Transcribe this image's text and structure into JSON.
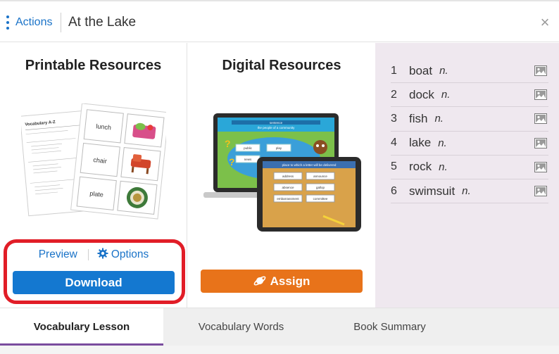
{
  "header": {
    "actions_label": "Actions",
    "title": "At the Lake",
    "close_symbol": "×"
  },
  "printable": {
    "title": "Printable Resources",
    "preview_label": "Preview",
    "options_label": "Options",
    "download_label": "Download",
    "worksheet_heading": "Vocabulary A-Z",
    "cards": [
      "lunch",
      "chair",
      "plate"
    ]
  },
  "digital": {
    "title": "Digital Resources",
    "assign_label": "Assign",
    "laptop_prompt": "sentence",
    "laptop_subprompt": "the people of a community",
    "laptop_answers": [
      "public",
      "play",
      "news"
    ],
    "tablet_prompt": "place to which a letter will be delivered",
    "tablet_answers": [
      "address",
      "announce",
      "absence",
      "gallop",
      "embarrassment",
      "committee"
    ]
  },
  "words": [
    {
      "num": "1",
      "word": "boat",
      "pos": "n."
    },
    {
      "num": "2",
      "word": "dock",
      "pos": "n."
    },
    {
      "num": "3",
      "word": "fish",
      "pos": "n."
    },
    {
      "num": "4",
      "word": "lake",
      "pos": "n."
    },
    {
      "num": "5",
      "word": "rock",
      "pos": "n."
    },
    {
      "num": "6",
      "word": "swimsuit",
      "pos": "n."
    }
  ],
  "tabs": [
    {
      "label": "Vocabulary Lesson",
      "active": true
    },
    {
      "label": "Vocabulary Words",
      "active": false
    },
    {
      "label": "Book Summary",
      "active": false
    }
  ],
  "colors": {
    "accent_blue": "#1478d0",
    "assign_orange": "#e8731a",
    "highlight_red": "#e11d27",
    "tab_active_underline": "#7a4c9e",
    "word_panel_bg": "#efe8ef"
  },
  "icons": [
    "kebab-menu-icon",
    "close-icon",
    "gear-icon",
    "planet-icon",
    "image-icon"
  ]
}
